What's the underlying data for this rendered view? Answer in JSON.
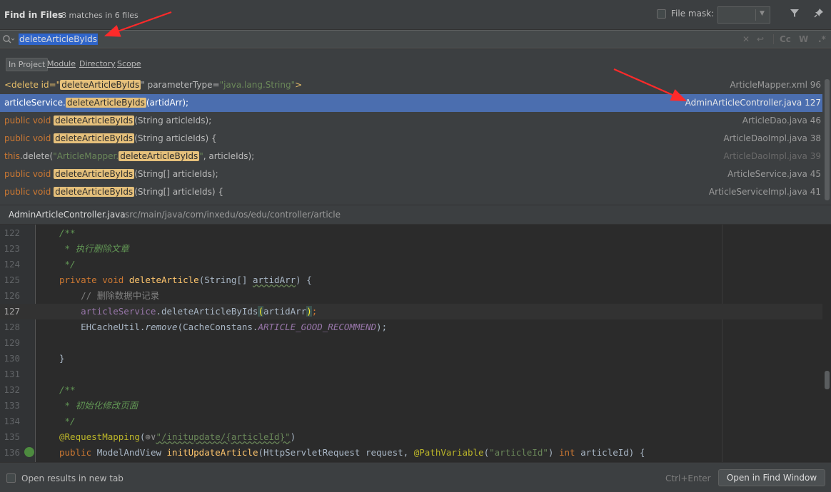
{
  "header": {
    "title": "Find in Files",
    "subtitle": "8 matches in 6 files",
    "file_mask_label": "File mask:",
    "file_mask_value": ""
  },
  "search": {
    "query": "deleteArticleByIds",
    "toggle_case": "Cc",
    "toggle_words": "W",
    "toggle_regex": ".*"
  },
  "scopes": [
    "In Project",
    "Module",
    "Directory",
    "Scope"
  ],
  "results": [
    {
      "file": "ArticleMapper.xml 96"
    },
    {
      "file": "AdminArticleController.java 127"
    },
    {
      "file": "ArticleDao.java 46"
    },
    {
      "file": "ArticleDaoImpl.java 38"
    },
    {
      "file": "ArticleDaoImpl.java 39"
    },
    {
      "file": "ArticleService.java 45"
    },
    {
      "file": "ArticleServiceImpl.java 41"
    }
  ],
  "result_snippets": {
    "r0_pre": "<delete id=\"",
    "r0_hl": "deleteArticleByIds",
    "r0_post_attr": "\" parameterType=",
    "r0_val": "\"java.lang.String\"",
    "r0_end": ">",
    "r1_pre": "articleService.",
    "r1_hl": "deleteArticleByIds",
    "r1_post": "(artidArr);",
    "r2_kw": "public void ",
    "r2_hl": "deleteArticleByIds",
    "r2_post": "(String articleIds);",
    "r3_kw": "public void ",
    "r3_hl": "deleteArticleByIds",
    "r3_post": "(String articleIds) {",
    "r4_kw": "this",
    "r4_pre": ".delete(",
    "r4_str": "\"ArticleMapper.",
    "r4_hl": "deleteArticleByIds",
    "r4_strend": "\"",
    "r4_post": ", articleIds);",
    "r5_kw": "public void ",
    "r5_hl": "deleteArticleByIds",
    "r5_post": "(String[] articleIds);",
    "r6_kw": "public void ",
    "r6_hl": "deleteArticleByIds",
    "r6_post": "(String[] articleIds) {"
  },
  "preview": {
    "file_name": "AdminArticleController.java",
    "file_path": "src/main/java/com/inxedu/os/edu/controller/article"
  },
  "code": {
    "n122": "122",
    "n123": "123",
    "n124": "124",
    "n125": "125",
    "n126": "126",
    "n127": "127",
    "n128": "128",
    "n129": "129",
    "n130": "130",
    "n131": "131",
    "n132": "132",
    "n133": "133",
    "n134": "134",
    "n135": "135",
    "n136": "136",
    "l122": "/**",
    "l123": " * 执行删除文章",
    "l124": " */",
    "l125_kw": "private void ",
    "l125_fn": "deleteArticle",
    "l125_a": "(String[] ",
    "l125_param": "artidArr",
    "l125_b": ") {",
    "l126": "    // 删除数据中记录",
    "l127_field": "    articleService",
    "l127_a": ".deleteArticleByIds",
    "l127_open": "(",
    "l127_arg": "artidArr",
    "l127_close": ")",
    "l127_end": ";",
    "l128_a": "    EHCacheUtil.",
    "l128_m": "remove",
    "l128_b": "(CacheConstans.",
    "l128_c": "ARTICLE_GOOD_RECOMMEND",
    "l128_d": ");",
    "l130": "}",
    "l132": "/**",
    "l133": " * 初始化修改页面",
    "l134": " */",
    "l135_ann": "@RequestMapping",
    "l135_a": "(",
    "l135_icon": "⊕∨",
    "l135_str": "\"/initupdate/{articleId}\"",
    "l135_b": ")",
    "l136_kw": "public ",
    "l136_a": "ModelAndView ",
    "l136_fn": "initUpdateArticle",
    "l136_b": "(HttpServletRequest request, ",
    "l136_ann": "@PathVariable",
    "l136_c": "(",
    "l136_str": "\"articleId\"",
    "l136_d": ") ",
    "l136_kw2": "int ",
    "l136_e": "articleId) {"
  },
  "footer": {
    "open_new_tab": "Open results in new tab",
    "shortcut": "Ctrl+Enter",
    "open_button": "Open in Find Window"
  },
  "colors": {
    "selection": "#4b6eaf",
    "match_highlight": "#e5c07b",
    "annotation_arrow": "#ff2a2a"
  }
}
